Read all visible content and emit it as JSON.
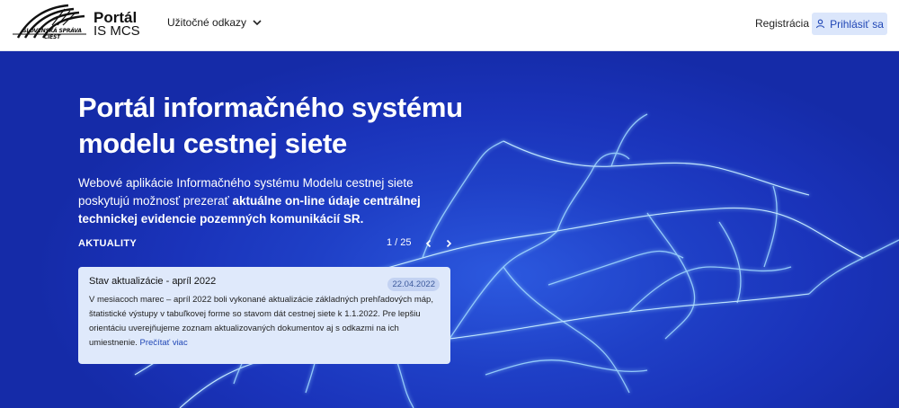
{
  "header": {
    "logo_caption": "SLOVENSKÁ SPRÁVA CIEST",
    "portal_line1": "Portál",
    "portal_line2": "IS MCS",
    "useful_links": "Užitočné odkazy",
    "register": "Registrácia",
    "login": "Prihlásiť sa"
  },
  "hero": {
    "title": "Portál informačného systému modelu cestnej siete",
    "desc_plain": "Webové aplikácie Informačného systému Modelu cestnej siete poskytujú možnosť prezerať ",
    "desc_bold": "aktuálne on-line údaje centrálnej technickej evidencie pozemných komunikácií SR.",
    "news_label": "AKTUALITY",
    "pager": "1 / 25"
  },
  "news": {
    "title": "Stav aktualizácie - apríl 2022",
    "date": "22.04.2022",
    "body": "V mesiacoch marec – apríl 2022 boli vykonané aktualizácie základných prehľadových máp, štatistické výstupy v tabuľkovej forme so stavom dát cestnej siete k 1.1.2022. Pre lepšiu orientáciu uverejňujeme zoznam aktualizovaných dokumentov aj s odkazmi na ich umiestnenie.",
    "read_more": "Prečítať viac"
  },
  "colors": {
    "hero_bg": "#1a33ba",
    "accent": "#1f46b5",
    "card_bg": "#dfe9fb",
    "network_glow": "#9fd8ff"
  },
  "icons": {
    "logo": "ssc-road-logo",
    "dropdown": "chevron-down-icon",
    "login": "user-icon",
    "prev": "chevron-left-icon",
    "next": "chevron-right-icon"
  }
}
